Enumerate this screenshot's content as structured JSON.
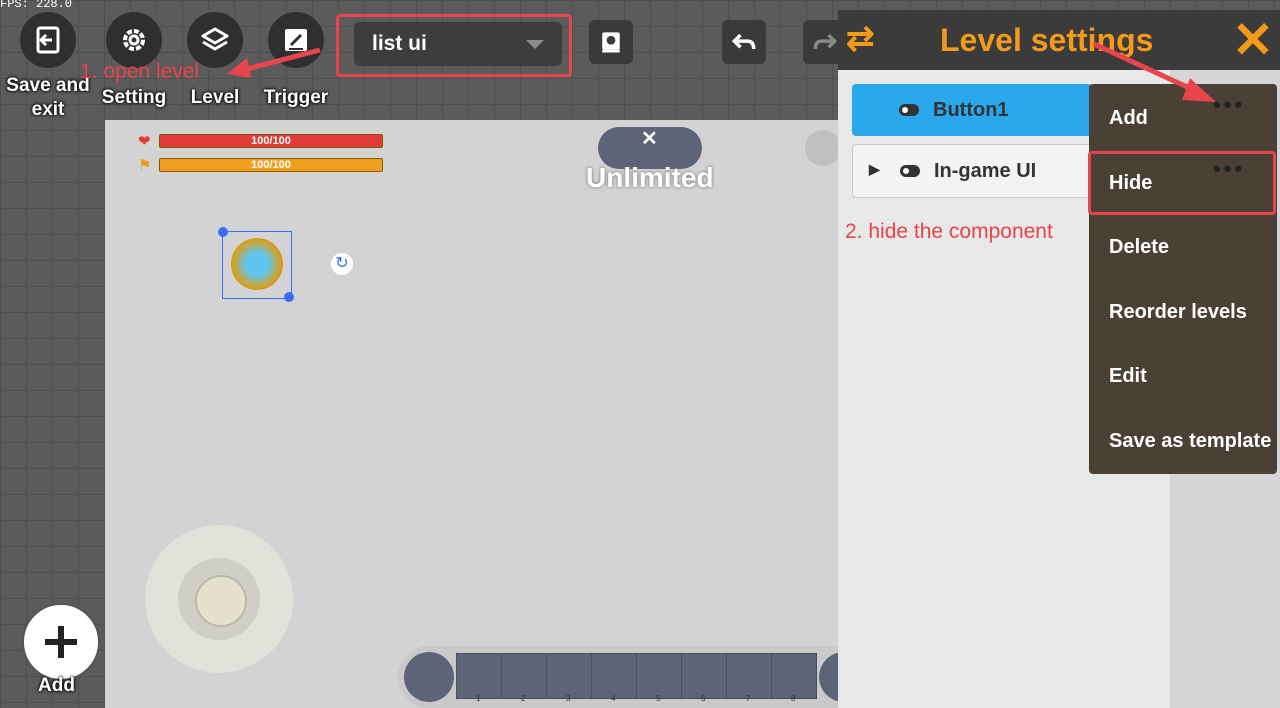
{
  "fps": "FPS: 228.0",
  "toolbar": {
    "save_exit": "Save and exit",
    "setting": "Setting",
    "level": "Level",
    "trigger": "Trigger"
  },
  "level_dropdown": {
    "value": "list ui"
  },
  "annotations": {
    "step1": "1. open level",
    "step2": "2. hide the component"
  },
  "hud": {
    "health": "100/100",
    "energy": "100/100",
    "timer_label": "Unlimited"
  },
  "add_button": "Add",
  "hotbar": {
    "slots": [
      "1",
      "2",
      "3",
      "4",
      "5",
      "6",
      "7",
      "8"
    ]
  },
  "panel": {
    "title": "Level settings",
    "rows": [
      {
        "label": "Button1",
        "selected": true
      },
      {
        "label": "In-game UI",
        "selected": false
      }
    ]
  },
  "context_menu": {
    "items": [
      "Add",
      "Hide",
      "Delete",
      "Reorder levels",
      "Edit",
      "Save as template"
    ]
  },
  "colors": {
    "accent_orange": "#f39a1a",
    "highlight_red": "#e8444b",
    "selected_blue": "#2aa8ee"
  }
}
